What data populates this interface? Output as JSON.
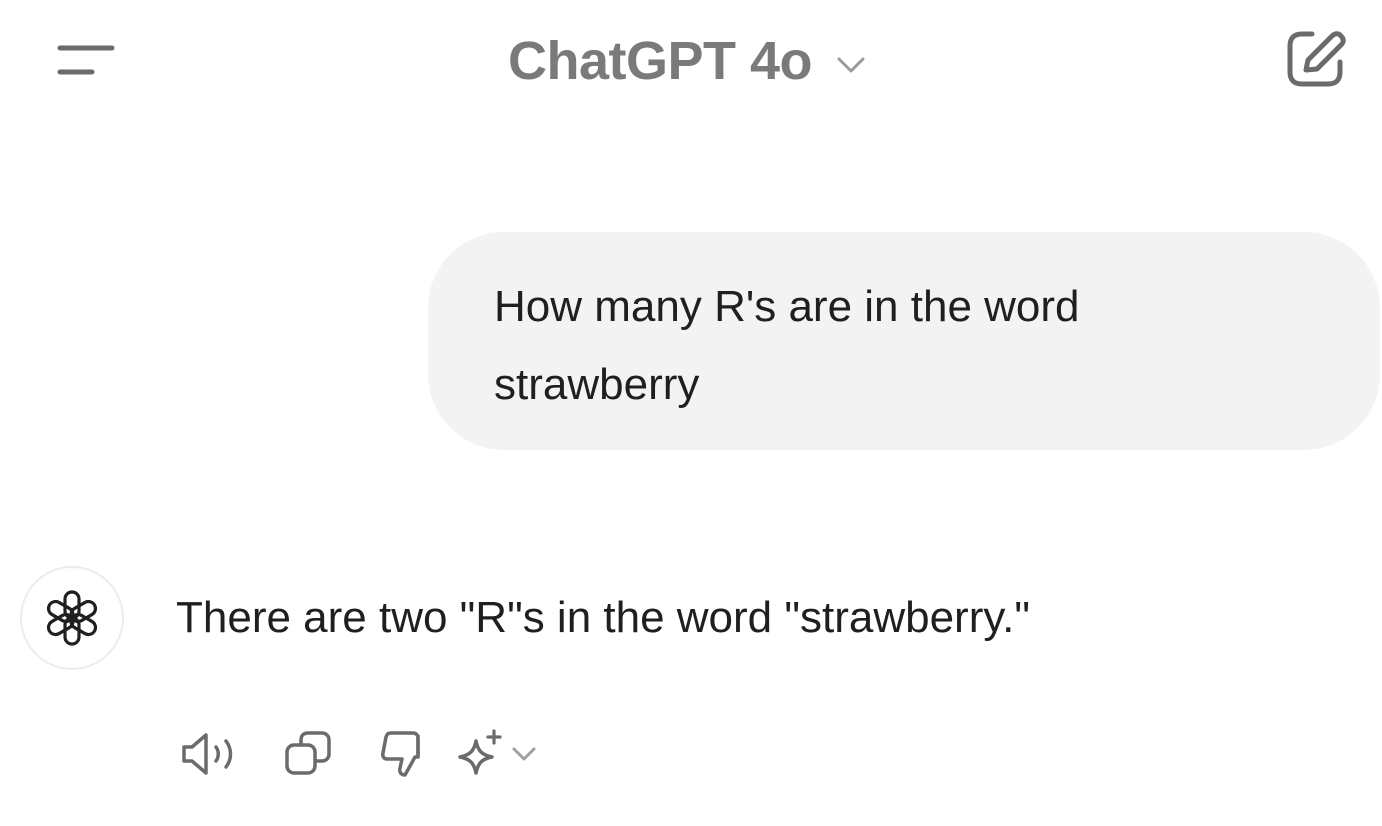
{
  "header": {
    "model_title": "ChatGPT 4o",
    "icons": {
      "menu": "menu-icon",
      "model_dropdown": "chevron-down-icon",
      "new_chat": "edit-icon"
    }
  },
  "conversation": {
    "user_message": "How many R's are in the word strawberry",
    "assistant_message": "There are two \"R\"s in the word \"strawberry.\"",
    "assistant_avatar_icon": "openai-logo-icon"
  },
  "actions": {
    "icons": [
      "speaker-icon",
      "copy-icon",
      "thumbs-down-icon",
      "sparkle-icon",
      "chevron-down-icon"
    ]
  },
  "colors": {
    "header_text": "#7a7a7a",
    "icon": "#6b6b6b",
    "bubble_bg": "#f3f3f3",
    "body_text": "#1f1f1f"
  }
}
